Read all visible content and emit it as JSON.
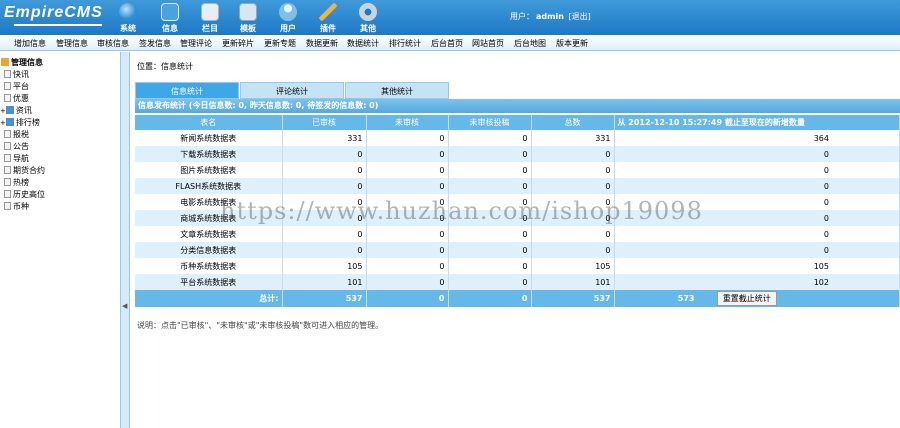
{
  "logo": "EmpireCMS",
  "nav": [
    {
      "label": "系统",
      "icon": "globe-icon",
      "color": "#2a8fd6"
    },
    {
      "label": "信息",
      "icon": "folder-icon",
      "color": "#4aa3e0"
    },
    {
      "label": "栏目",
      "icon": "folder-open-icon",
      "color": "#e8eef5"
    },
    {
      "label": "模板",
      "icon": "template-icon",
      "color": "#d8e6f2"
    },
    {
      "label": "用户",
      "icon": "user-icon",
      "color": "#7fc0ea"
    },
    {
      "label": "插件",
      "icon": "tools-icon",
      "color": "#f0b43c"
    },
    {
      "label": "其他",
      "icon": "gear-icon",
      "color": "#c9d4df"
    }
  ],
  "user": {
    "label": "用户：",
    "name": "admin",
    "logout": "[退出]"
  },
  "menu": [
    "增加信息",
    "管理信息",
    "审核信息",
    "签发信息",
    "管理评论",
    "更新碎片",
    "更新专题",
    "数据更新",
    "数据统计",
    "排行统计",
    "后台首页",
    "网站首页",
    "后台地图",
    "版本更新"
  ],
  "sidebar": {
    "root": "管理信息",
    "items": [
      "快讯",
      "平台",
      "优惠",
      "资讯",
      "排行榜",
      "报税",
      "公告",
      "导航",
      "期货合约",
      "热榜",
      "历史高位",
      "币种"
    ]
  },
  "position": "位置：信息统计",
  "tabs": [
    "信息统计",
    "评论统计",
    "其他统计"
  ],
  "summary": "信息发布统计 (今日信息数: 0, 昨天信息数: 0, 待签发的信息数: 0)",
  "table": {
    "headers": [
      "表名",
      "已审核",
      "未审核",
      "未审核投稿",
      "总数",
      "从 2012-12-10 15:27:49 截止至现在的新增数量"
    ],
    "rows": [
      [
        "新闻系统数据表",
        "331",
        "0",
        "0",
        "331",
        "364"
      ],
      [
        "下载系统数据表",
        "0",
        "0",
        "0",
        "0",
        "0"
      ],
      [
        "图片系统数据表",
        "0",
        "0",
        "0",
        "0",
        "0"
      ],
      [
        "FLASH系统数据表",
        "0",
        "0",
        "0",
        "0",
        "0"
      ],
      [
        "电影系统数据表",
        "0",
        "0",
        "0",
        "0",
        "0"
      ],
      [
        "商城系统数据表",
        "0",
        "0",
        "0",
        "0",
        "0"
      ],
      [
        "文章系统数据表",
        "0",
        "0",
        "0",
        "0",
        "0"
      ],
      [
        "分类信息数据表",
        "0",
        "0",
        "0",
        "0",
        "0"
      ],
      [
        "币种系统数据表",
        "105",
        "0",
        "0",
        "105",
        "105"
      ],
      [
        "平台系统数据表",
        "101",
        "0",
        "0",
        "101",
        "102"
      ]
    ],
    "total": [
      "总计:",
      "537",
      "0",
      "0",
      "537",
      "573"
    ],
    "reset_btn": "重置截止统计"
  },
  "note": "说明：点击\"已审核\"、\"未审核\"或\"未审核投稿\"数可进入相应的管理。",
  "watermark": "https://www.huzhan.com/ishop19098"
}
